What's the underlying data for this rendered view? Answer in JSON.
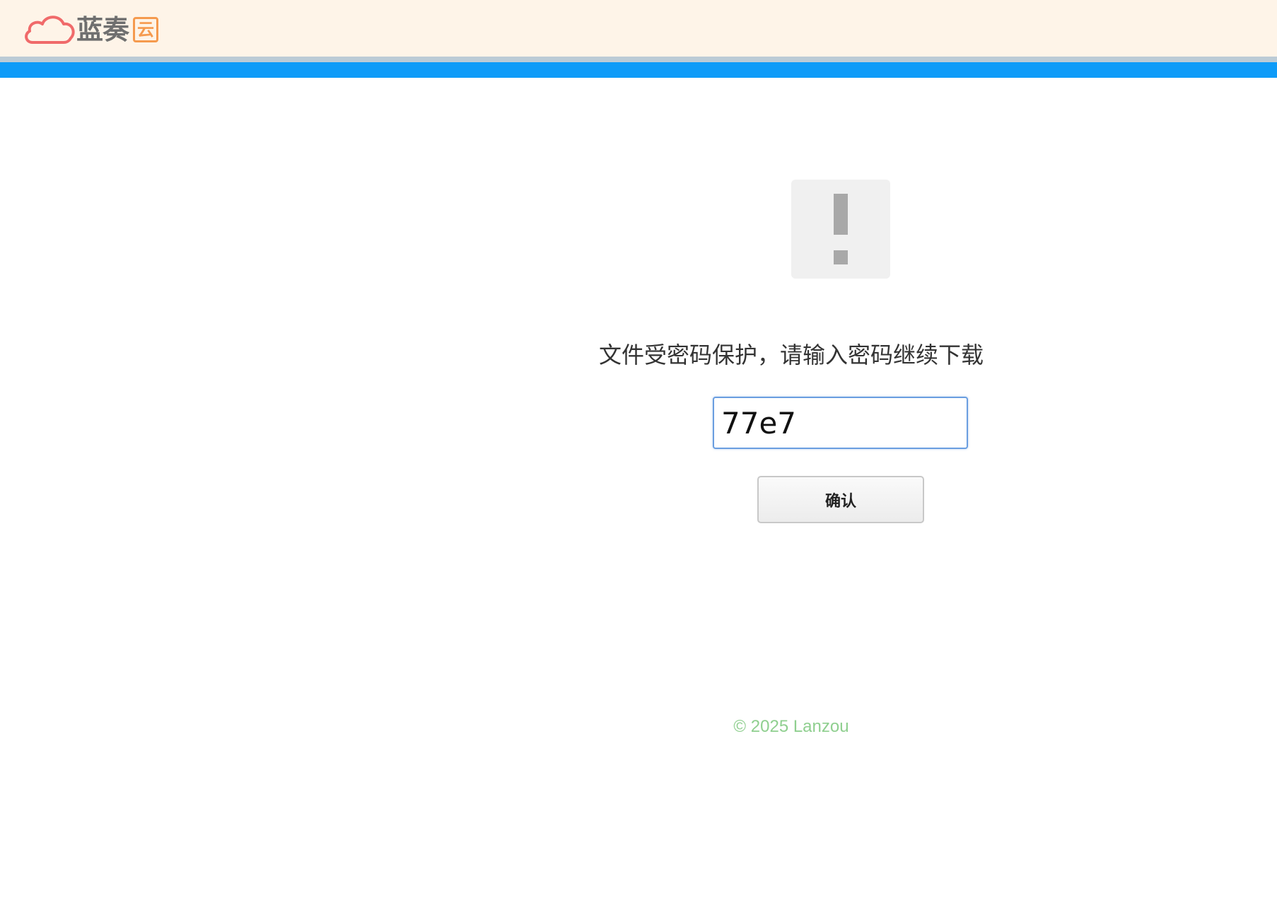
{
  "header": {
    "logo_text": "蓝奏",
    "logo_badge": "云",
    "cloud_icon": "cloud-icon",
    "colors": {
      "background": "#fef4e8",
      "stripe": "#0e9bf8",
      "cloud": "#f06a6a",
      "badge": "#f59a4e"
    }
  },
  "main": {
    "warning_icon": "exclamation-icon",
    "prompt": "文件受密码保护，请输入密码继续下载",
    "password_value": "77e7",
    "confirm_label": "确认"
  },
  "footer": {
    "copyright": "© 2025 Lanzou"
  }
}
